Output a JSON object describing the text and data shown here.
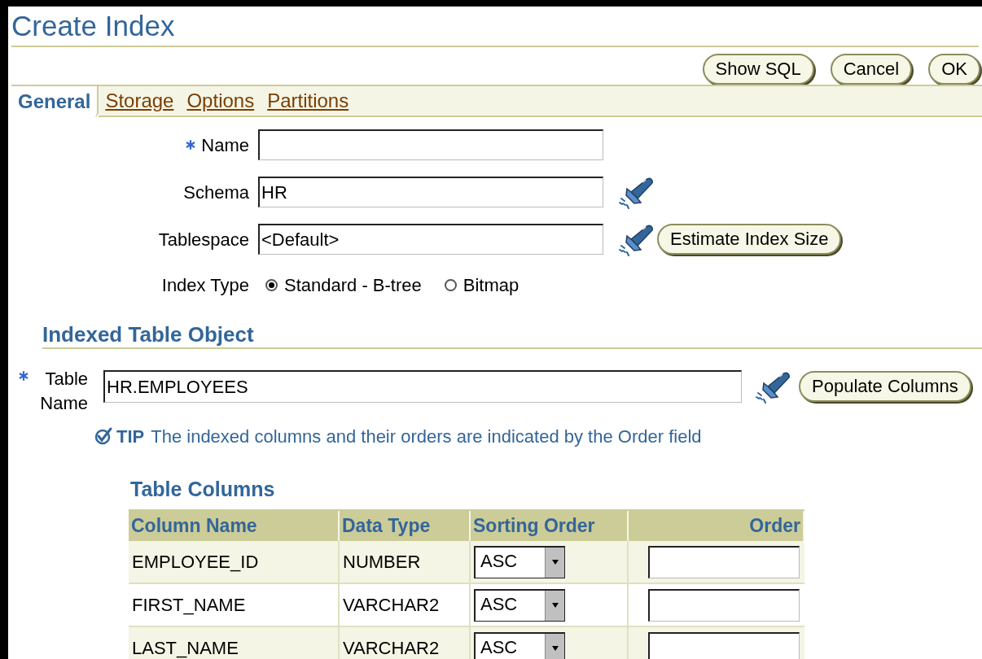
{
  "title": "Create Index",
  "buttons": [
    "Show SQL",
    "Cancel",
    "OK"
  ],
  "tabs": [
    {
      "label": "General",
      "selected": true
    },
    {
      "label": "Storage",
      "selected": false
    },
    {
      "label": "Options",
      "selected": false
    },
    {
      "label": "Partitions",
      "selected": false
    }
  ],
  "fields": [
    {
      "label": "Name",
      "required": true,
      "lookup": false
    },
    {
      "label": "Schema",
      "required": false,
      "value": "HR",
      "lookup": true
    },
    {
      "label": "Tablespace",
      "required": false,
      "value": "<Default>",
      "lookup": true,
      "button": "Estimate Index Size"
    }
  ],
  "index_type": {
    "label": "Index Type",
    "options": [
      {
        "label": "Standard - B-tree",
        "selected": true
      },
      {
        "label": "Bitmap",
        "selected": false
      }
    ]
  },
  "indexed_table_object": {
    "title": "Indexed Table Object",
    "table_name": {
      "label": "Table Name",
      "required": true,
      "value": "HR.EMPLOYEES",
      "lookup": true,
      "button": "Populate Columns"
    },
    "tip": {
      "label": "TIP",
      "text": "The indexed columns and their orders are indicated by the Order field"
    }
  },
  "table": {
    "title": "Table Columns",
    "columns": [
      "Column Name",
      "Data Type",
      "Sorting Order",
      "Order"
    ],
    "rows": [
      {
        "column_name": "EMPLOYEE_ID",
        "data_type": "NUMBER",
        "sorting_order": "ASC"
      },
      {
        "column_name": "FIRST_NAME",
        "data_type": "VARCHAR2",
        "sorting_order": "ASC"
      },
      {
        "column_name": "LAST_NAME",
        "data_type": "VARCHAR2",
        "sorting_order": "ASC"
      }
    ]
  }
}
